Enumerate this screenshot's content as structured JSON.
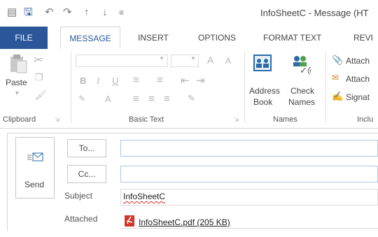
{
  "window": {
    "title": "InfoSheetC - Message (HT"
  },
  "tabs": [
    {
      "label": "FILE"
    },
    {
      "label": "MESSAGE"
    },
    {
      "label": "INSERT"
    },
    {
      "label": "OPTIONS"
    },
    {
      "label": "FORMAT TEXT"
    },
    {
      "label": "REVI"
    }
  ],
  "ribbon": {
    "clipboard": {
      "paste_label": "Paste",
      "group_label": "Clipboard"
    },
    "basic_text": {
      "bold": "B",
      "italic": "I",
      "underline": "U",
      "grow": "A",
      "shrink": "A",
      "group_label": "Basic Text"
    },
    "names": {
      "address_book_line1": "Address",
      "address_book_line2": "Book",
      "check_names_line1": "Check",
      "check_names_line2": "Names",
      "group_label": "Names"
    },
    "include": {
      "attach_file": "Attach",
      "attach_item": "Attach",
      "signature": "Signat",
      "group_label": "Inclu"
    }
  },
  "compose": {
    "send_label": "Send",
    "to_label": "To...",
    "cc_label": "Cc...",
    "to_value": "",
    "cc_value": "",
    "subject_label": "Subject",
    "subject_value": "InfoSheetC",
    "attached_label": "Attached",
    "attachment": "InfoSheetC.pdf (205 KB)"
  },
  "colors": {
    "accent": "#2b579a",
    "pdf": "#d4352b"
  }
}
